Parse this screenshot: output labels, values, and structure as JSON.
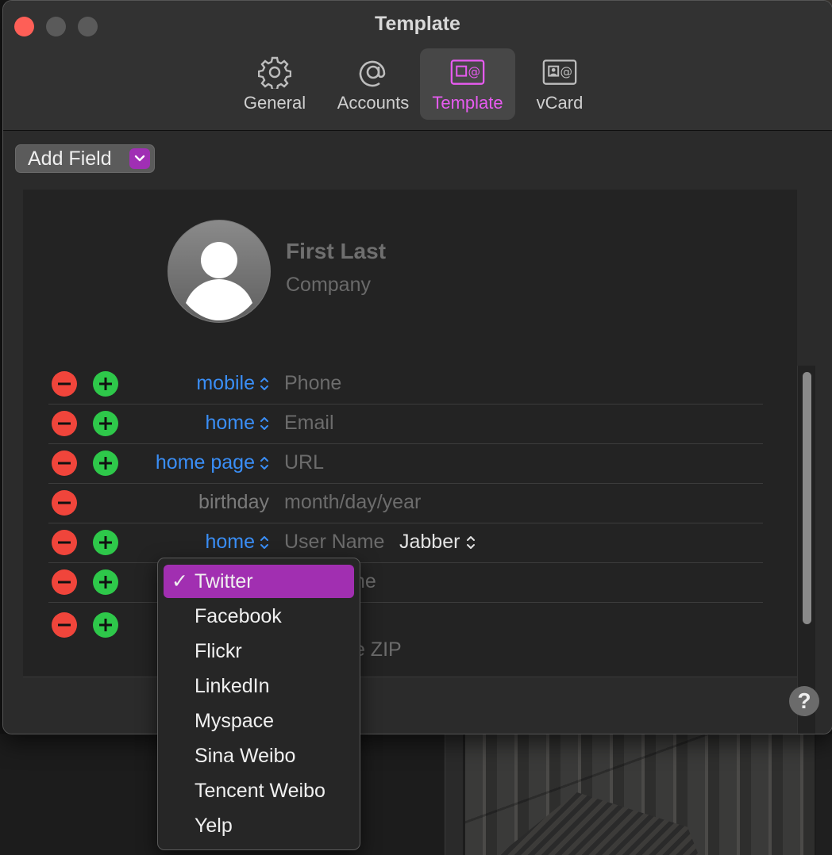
{
  "window": {
    "title": "Template"
  },
  "tabs": [
    {
      "label": "General",
      "icon": "gear-icon"
    },
    {
      "label": "Accounts",
      "icon": "at-sign-icon"
    },
    {
      "label": "Template",
      "icon": "template-card-icon",
      "active": true
    },
    {
      "label": "vCard",
      "icon": "vcard-icon"
    }
  ],
  "toolbar": {
    "add_field_label": "Add Field"
  },
  "card": {
    "name": "First  Last",
    "company": "Company"
  },
  "rows": [
    {
      "label": "mobile",
      "value": "Phone"
    },
    {
      "label": "home",
      "value": "Email"
    },
    {
      "label": "home page",
      "value": "URL"
    },
    {
      "label": "birthday",
      "value": "month/day/year"
    },
    {
      "label": "home",
      "value": "User Name",
      "extra": "Jabber"
    },
    {
      "value_partial": "me"
    },
    {
      "value_partial": "te ZIP"
    }
  ],
  "menu": {
    "items": [
      "Twitter",
      "Facebook",
      "Flickr",
      "LinkedIn",
      "Myspace",
      "Sina Weibo",
      "Tencent Weibo",
      "Yelp"
    ],
    "selected": "Twitter",
    "check_glyph": "✓"
  },
  "help": {
    "label": "?"
  },
  "colors": {
    "accent": "#a12fb1",
    "accent_text": "#e75bf0",
    "link_blue": "#3a8ef6",
    "remove_red": "#f0453b",
    "add_green": "#2ec84a"
  }
}
